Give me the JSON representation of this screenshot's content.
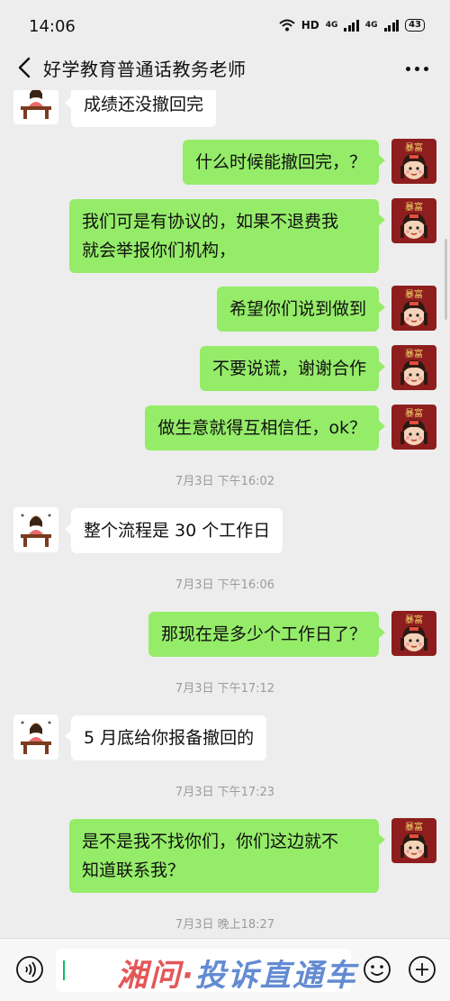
{
  "status_bar": {
    "time": "14:06",
    "hd_label": "HD",
    "network_1": "4G",
    "network_2": "4G",
    "battery": "43"
  },
  "nav": {
    "title": "好学教育普通话教务老师"
  },
  "chat": {
    "msg1": "成绩还没撤回完",
    "msg2": "什么时候能撤回完，？",
    "msg3_line1": "我们可是有协议的，如果不退费我",
    "msg3_line2": "就会举报你们机构，",
    "msg4": "希望你们说到做到",
    "msg5": "不要说谎，谢谢合作",
    "msg6": "做生意就得互相信任，ok？",
    "ts1": "7月3日 下午16:02",
    "msg7": "整个流程是 30 个工作日",
    "ts2": "7月3日 下午16:06",
    "msg8": "那现在是多少个工作日了？",
    "ts3": "7月3日 下午17:12",
    "msg9": "5 月底给你报备撤回的",
    "ts4": "7月3日 下午17:23",
    "msg10_line1": "是不是我不找你们，你们这边就不",
    "msg10_line2": "知道联系我？",
    "ts5": "7月3日 晚上18:27"
  },
  "watermark": {
    "part1": "湘问·",
    "part2": "投诉直通车"
  },
  "colors": {
    "background": "#ededed",
    "sent_bubble": "#95ec69",
    "received_bubble": "#ffffff",
    "timestamp": "#9b9b9b",
    "cursor": "#07c160"
  },
  "icons": {
    "back": "chevron-left-icon",
    "more": "more-dots-icon",
    "voice": "voice-icon",
    "emoji": "emoji-icon",
    "plus": "plus-icon"
  }
}
